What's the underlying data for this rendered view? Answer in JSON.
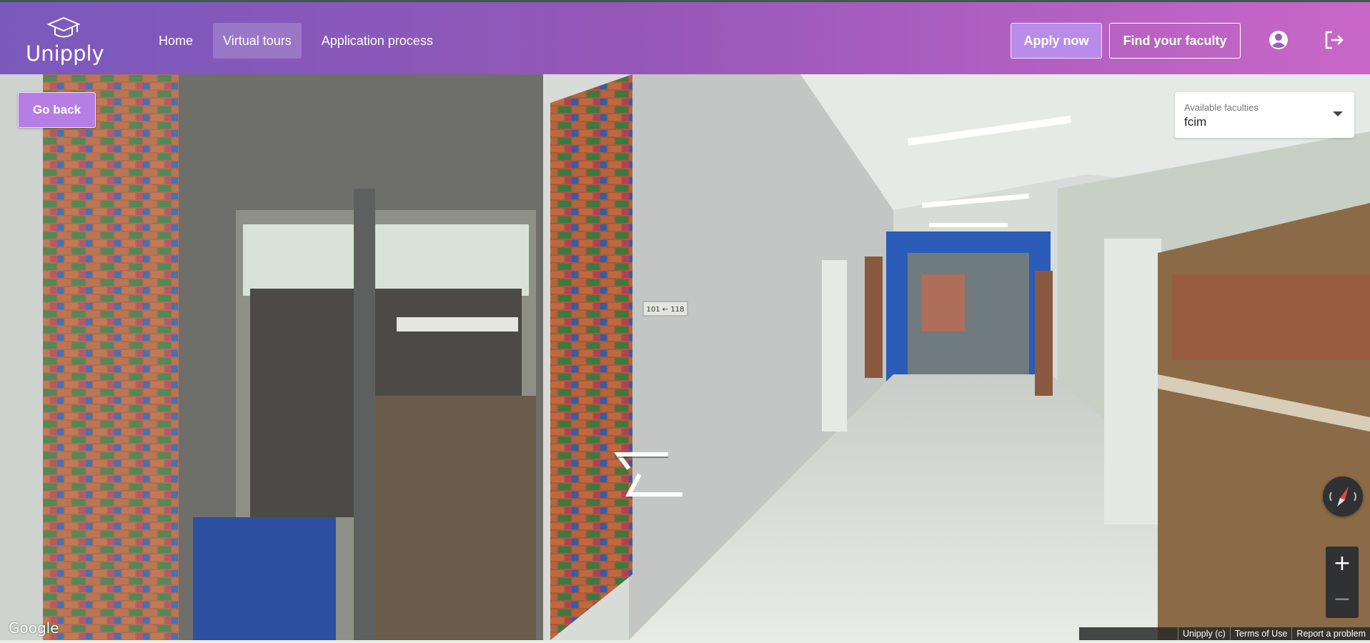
{
  "app": {
    "name": "Unipply",
    "logo_icon": "graduation-cap-icon"
  },
  "nav": {
    "items": [
      {
        "label": "Home",
        "active": false
      },
      {
        "label": "Virtual tours",
        "active": true
      },
      {
        "label": "Application process",
        "active": false
      }
    ]
  },
  "header": {
    "apply_label": "Apply now",
    "find_label": "Find your faculty",
    "account_icon": "account-circle-icon",
    "logout_icon": "logout-icon"
  },
  "tour": {
    "go_back_label": "Go back",
    "faculty_select": {
      "label": "Available faculties",
      "value": "fcim"
    },
    "room_sign": "101 ← 118",
    "zoom_in": "+",
    "zoom_out": "−",
    "google_label": "Google",
    "footer_links": [
      "Unipply (c)",
      "Terms of Use",
      "Report a problem"
    ]
  },
  "colors": {
    "header_start": "#7a59bd",
    "header_end": "#c967c8",
    "button_accent": "#b67ee4"
  }
}
